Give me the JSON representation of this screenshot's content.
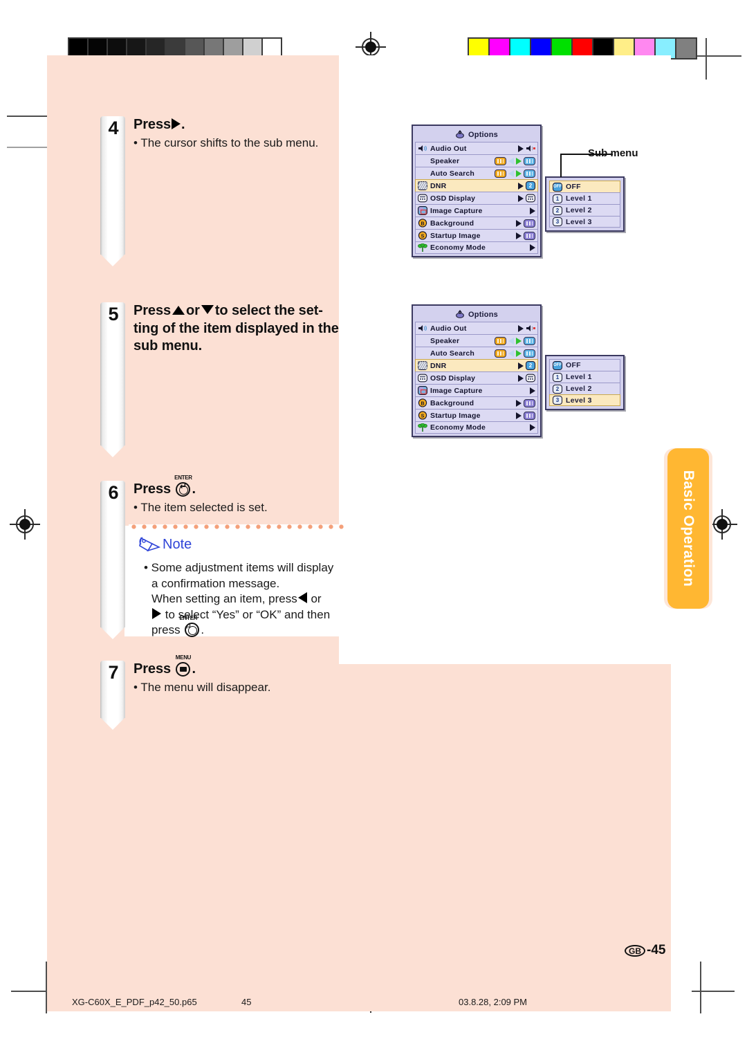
{
  "document": {
    "page_label_region": "GB",
    "page_number": "-45",
    "side_tab": "Basic Operation",
    "footer_filename": "XG-C60X_E_PDF_p42_50.p65",
    "footer_page": "45",
    "footer_timestamp": "03.8.28, 2:09 PM"
  },
  "steps": [
    {
      "number": "4",
      "heading_prefix": "Press",
      "heading_suffix": ".",
      "bullet": "• The cursor shifts to the sub menu."
    },
    {
      "number": "5",
      "heading_line1_a": "Press",
      "heading_line1_b": "or",
      "heading_line1_c": "to select the set-",
      "heading_line2": "ting of the item displayed in the",
      "heading_line3": "sub menu."
    },
    {
      "number": "6",
      "heading_prefix": "Press",
      "key_cap": "ENTER",
      "heading_suffix": ".",
      "bullet": "• The item selected is set."
    },
    {
      "number": "7",
      "heading_prefix": "Press",
      "key_cap": "MENU",
      "heading_suffix": ".",
      "bullet": "• The menu will disappear."
    }
  ],
  "note": {
    "title": "Note",
    "line1": "• Some adjustment items will display",
    "line2": "a confirmation message.",
    "line3_a": "When setting an item, press",
    "line3_b": "or",
    "line4_a": "to select “Yes” or “OK” and then",
    "line5_a": "press",
    "line5_b": ".",
    "key_cap": "ENTER",
    "accent_color": "#2f45d8"
  },
  "callout": {
    "label": "Sub menu"
  },
  "osd_menus": [
    {
      "id": "menu-top",
      "title": "Options",
      "rows": [
        {
          "label": "Audio Out",
          "icon": "speaker-out-icon",
          "arrow": "black",
          "value": "speaker-mute-icon"
        },
        {
          "label": "Speaker",
          "icon": "none",
          "arrow": "toggle",
          "value_left": "amber",
          "value_right": "blue"
        },
        {
          "label": "Auto Search",
          "icon": "none",
          "arrow": "toggle",
          "value_left": "amber",
          "value_right": "blue"
        },
        {
          "label": "DNR",
          "icon": "dnr-icon",
          "arrow": "black",
          "value": "2",
          "selected": true
        },
        {
          "label": "OSD Display",
          "icon": "osd-icon",
          "arrow": "black",
          "value": "osd-icon"
        },
        {
          "label": "Image Capture",
          "icon": "capture-icon",
          "arrow": "black",
          "value": ""
        },
        {
          "label": "Background",
          "icon": "background-icon",
          "arrow": "black",
          "value": "violet"
        },
        {
          "label": "Startup Image",
          "icon": "startup-icon",
          "arrow": "black",
          "value": "violet"
        },
        {
          "label": "Economy Mode",
          "icon": "eco-icon",
          "arrow": "black",
          "value": ""
        }
      ],
      "submenu": {
        "rows": [
          {
            "label": "OFF",
            "badge": "OFF",
            "selected": true
          },
          {
            "label": "Level 1",
            "badge": "1",
            "selected": false
          },
          {
            "label": "Level 2",
            "badge": "2",
            "selected": false
          },
          {
            "label": "Level 3",
            "badge": "3",
            "selected": false
          }
        ]
      }
    },
    {
      "id": "menu-bottom",
      "title": "Options",
      "rows": [
        {
          "label": "Audio Out",
          "icon": "speaker-out-icon",
          "arrow": "black",
          "value": "speaker-mute-icon"
        },
        {
          "label": "Speaker",
          "icon": "none",
          "arrow": "toggle",
          "value_left": "amber",
          "value_right": "blue"
        },
        {
          "label": "Auto Search",
          "icon": "none",
          "arrow": "toggle",
          "value_left": "amber",
          "value_right": "blue"
        },
        {
          "label": "DNR",
          "icon": "dnr-icon",
          "arrow": "black",
          "value": "2",
          "selected": true
        },
        {
          "label": "OSD Display",
          "icon": "osd-icon",
          "arrow": "black",
          "value": "osd-icon"
        },
        {
          "label": "Image Capture",
          "icon": "capture-icon",
          "arrow": "black",
          "value": ""
        },
        {
          "label": "Background",
          "icon": "background-icon",
          "arrow": "black",
          "value": "violet"
        },
        {
          "label": "Startup Image",
          "icon": "startup-icon",
          "arrow": "black",
          "value": "violet"
        },
        {
          "label": "Economy Mode",
          "icon": "eco-icon",
          "arrow": "black",
          "value": ""
        }
      ],
      "submenu": {
        "rows": [
          {
            "label": "OFF",
            "badge": "OFF",
            "selected": false
          },
          {
            "label": "Level 1",
            "badge": "1",
            "selected": false
          },
          {
            "label": "Level 2",
            "badge": "2",
            "selected": false
          },
          {
            "label": "Level 3",
            "badge": "3",
            "selected": true
          }
        ]
      }
    }
  ],
  "calibration": {
    "grayscale": [
      "#000000",
      "#050505",
      "#0d0d0d",
      "#171717",
      "#262626",
      "#3b3b3b",
      "#575757",
      "#777777",
      "#9e9e9e",
      "#d0d0d0",
      "#ffffff"
    ],
    "colors": [
      "#ffff00",
      "#ff00ff",
      "#00ffff",
      "#0000ff",
      "#00e000",
      "#ff0000",
      "#000000",
      "#ffee88",
      "#ff88f0",
      "#88eeff",
      "#808080"
    ]
  }
}
